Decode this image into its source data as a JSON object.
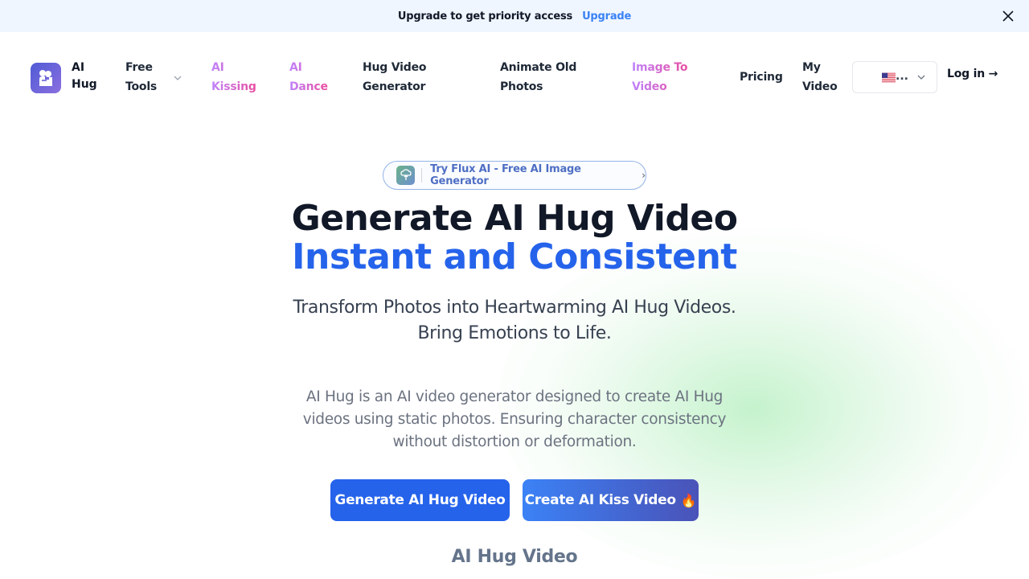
{
  "banner": {
    "message": "Upgrade to get priority access",
    "link_label": "Upgrade"
  },
  "nav": {
    "brand": "AI Hug",
    "items": [
      {
        "label": "Free Tools",
        "has_dropdown": true
      },
      {
        "label": "AI Kissing",
        "highlight": true
      },
      {
        "label": "AI Dance",
        "highlight": true
      },
      {
        "label": "Hug Video Generator"
      },
      {
        "label": "Animate Old Photos"
      },
      {
        "label": "Image To Video",
        "highlight": true
      },
      {
        "label": "Pricing"
      },
      {
        "label": "My Video"
      }
    ],
    "language": {
      "selected": "🇺🇸...",
      "truncated": "..."
    },
    "login_label": "Log in →"
  },
  "hero": {
    "pill_label": "Try Flux AI - Free AI Image Generator",
    "pill_arrow": "›",
    "title_line1": "Generate AI Hug Video",
    "title_line2": "Instant and Consistent",
    "subtitle_line1": "Transform Photos into Heartwarming AI Hug Videos.",
    "subtitle_line2": "Bring Emotions to Life.",
    "description": "AI Hug is an AI video generator designed to create AI Hug videos using static photos. Ensuring character consistency without distortion or deformation.",
    "primary_button": "Generate AI Hug Video",
    "secondary_button": "Create AI Kiss Video",
    "secondary_emoji": "🔥"
  },
  "section": {
    "title": "AI Hug Video"
  },
  "colors": {
    "accent": "#2563eb",
    "banner_bg": "#eff6ff",
    "link": "#3b82f6",
    "highlight_start": "#c084fc",
    "highlight_end": "#ec4899"
  }
}
